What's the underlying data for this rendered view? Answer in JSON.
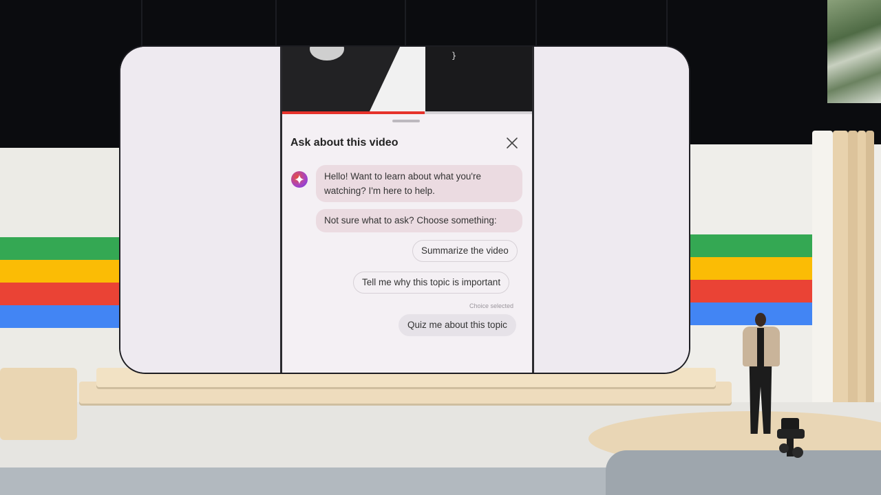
{
  "video": {
    "code_glyph": "}",
    "progress_percent": 57
  },
  "panel": {
    "title": "Ask about this video",
    "close_icon": "close-icon",
    "assistant_icon": "gemini-sparkle-icon"
  },
  "messages": {
    "greeting": "Hello! Want to learn about what you're watching? I'm here to help.",
    "prompt": "Not sure what to ask? Choose something:"
  },
  "suggestions": [
    {
      "label": "Summarize the video"
    },
    {
      "label": "Tell me why this topic is important"
    }
  ],
  "selection": {
    "status": "Choice selected",
    "label": "Quiz me about this topic"
  },
  "colors": {
    "progress": "#e6322b",
    "bubble": "#ebdbe1",
    "stripe_green": "#34a853",
    "stripe_yellow": "#fbbc05",
    "stripe_red": "#ea4335",
    "stripe_blue": "#4285f4"
  }
}
